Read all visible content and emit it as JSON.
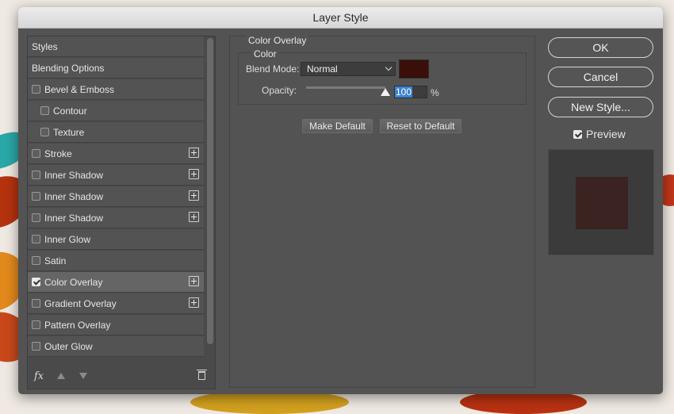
{
  "dialog": {
    "title": "Layer Style"
  },
  "styles": [
    {
      "label": "Styles",
      "type": "header",
      "checkbox": false,
      "plus": false
    },
    {
      "label": "Blending Options",
      "type": "header",
      "checkbox": false,
      "plus": false
    },
    {
      "label": "Bevel & Emboss",
      "type": "item",
      "checkbox": true,
      "checked": false,
      "plus": false
    },
    {
      "label": "Contour",
      "type": "sub",
      "checkbox": true,
      "checked": false,
      "plus": false
    },
    {
      "label": "Texture",
      "type": "sub",
      "checkbox": true,
      "checked": false,
      "plus": false
    },
    {
      "label": "Stroke",
      "type": "item",
      "checkbox": true,
      "checked": false,
      "plus": true
    },
    {
      "label": "Inner Shadow",
      "type": "item",
      "checkbox": true,
      "checked": false,
      "plus": true
    },
    {
      "label": "Inner Shadow",
      "type": "item",
      "checkbox": true,
      "checked": false,
      "plus": true
    },
    {
      "label": "Inner Shadow",
      "type": "item",
      "checkbox": true,
      "checked": false,
      "plus": true
    },
    {
      "label": "Inner Glow",
      "type": "item",
      "checkbox": true,
      "checked": false,
      "plus": false
    },
    {
      "label": "Satin",
      "type": "item",
      "checkbox": true,
      "checked": false,
      "plus": false
    },
    {
      "label": "Color Overlay",
      "type": "item",
      "checkbox": true,
      "checked": true,
      "plus": true,
      "selected": true
    },
    {
      "label": "Gradient Overlay",
      "type": "item",
      "checkbox": true,
      "checked": false,
      "plus": true
    },
    {
      "label": "Pattern Overlay",
      "type": "item",
      "checkbox": true,
      "checked": false,
      "plus": false
    },
    {
      "label": "Outer Glow",
      "type": "item",
      "checkbox": true,
      "checked": false,
      "plus": false
    }
  ],
  "footer": {
    "fx_label": "fx"
  },
  "overlay": {
    "group_title": "Color Overlay",
    "sub_title": "Color",
    "blend_mode_label": "Blend Mode:",
    "blend_mode_value": "Normal",
    "color_swatch": "#3a0f0a",
    "opacity_label": "Opacity:",
    "opacity_value": "100",
    "opacity_unit": "%",
    "opacity_fraction": 1.0,
    "make_default": "Make Default",
    "reset_default": "Reset to Default"
  },
  "actions": {
    "ok": "OK",
    "cancel": "Cancel",
    "new_style": "New Style...",
    "preview_label": "Preview",
    "preview_checked": true,
    "preview_color": "#3a2320"
  }
}
